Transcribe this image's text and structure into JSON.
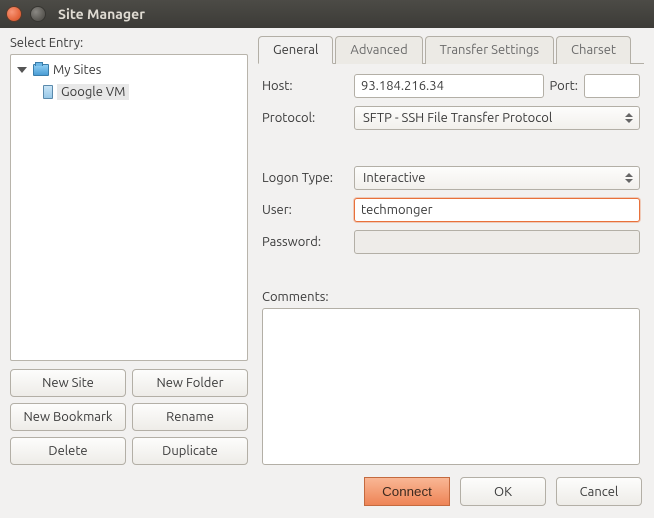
{
  "window": {
    "title": "Site Manager"
  },
  "left": {
    "select_entry": "Select Entry:",
    "root": "My Sites",
    "site": "Google VM",
    "buttons": {
      "new_site": "New Site",
      "new_folder": "New Folder",
      "new_bookmark": "New Bookmark",
      "rename": "Rename",
      "delete": "Delete",
      "duplicate": "Duplicate"
    }
  },
  "tabs": {
    "general": "General",
    "advanced": "Advanced",
    "transfer": "Transfer Settings",
    "charset": "Charset"
  },
  "form": {
    "host_label": "Host:",
    "host_value": "93.184.216.34",
    "port_label": "Port:",
    "port_value": "",
    "protocol_label": "Protocol:",
    "protocol_value": "SFTP - SSH File Transfer Protocol",
    "logon_type_label": "Logon Type:",
    "logon_type_value": "Interactive",
    "user_label": "User:",
    "user_value": "techmonger",
    "password_label": "Password:",
    "password_value": "",
    "comments_label": "Comments:",
    "comments_value": ""
  },
  "actions": {
    "connect": "Connect",
    "ok": "OK",
    "cancel": "Cancel"
  }
}
